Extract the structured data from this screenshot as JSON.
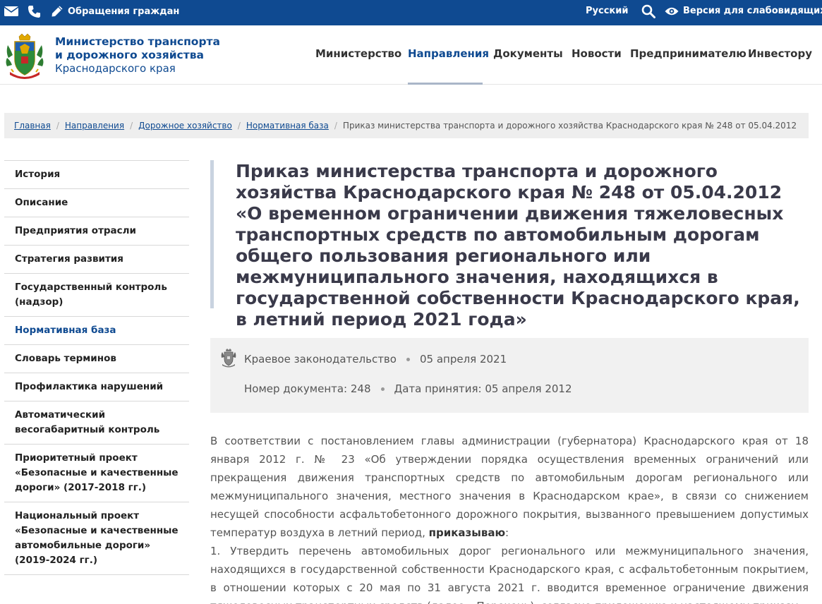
{
  "topbar": {
    "appeals_label": "Обращения граждан",
    "language_label": "Русский",
    "vision_label": "Версия для слабовидящих"
  },
  "header": {
    "org_line1": "Министерство транспорта",
    "org_line2": "и дорожного хозяйства",
    "org_line3": "Краснодарского края",
    "nav": [
      {
        "label": "Министерство"
      },
      {
        "label": "Направления"
      },
      {
        "label": "Документы"
      },
      {
        "label": "Новости"
      },
      {
        "label": "Предпринимателю"
      },
      {
        "label": "Инвестору"
      }
    ],
    "active_nav": "Направления"
  },
  "breadcrumb": {
    "items": [
      "Главная",
      "Направления",
      "Дорожное хозяйство",
      "Нормативная база"
    ],
    "current": "Приказ министерства транспорта и дорожного хозяйства Краснодарского края № 248 от 05.04.2012"
  },
  "sidebar": {
    "items": [
      {
        "label": "История"
      },
      {
        "label": "Описание"
      },
      {
        "label": "Предприятия отрасли"
      },
      {
        "label": "Стратегия развития"
      },
      {
        "label": "Государственный контроль (надзор)"
      },
      {
        "label": "Нормативная база"
      },
      {
        "label": "Словарь терминов"
      },
      {
        "label": "Профилактика нарушений"
      },
      {
        "label": "Автоматический весогабаритный контроль"
      },
      {
        "label": "Приоритетный проект «Безопасные и качественные дороги» (2017-2018 гг.)"
      },
      {
        "label": "Национальный проект «Безопасные и качественные автомобильные дороги» (2019-2024 гг.)"
      }
    ],
    "active": "Нормативная база"
  },
  "document": {
    "title": "Приказ министерства транспорта и дорожного хозяйства Краснодарского края № 248 от 05.04.2012 «О временном ограничении движения тяжеловесных транспортных средств по автомобильным дорогам общего пользования регионального или межмуниципального значения, находящихся в государственной собственности Краснодарского края, в летний период 2021 года»",
    "category": "Краевое законодательство",
    "publish_date": "05 апреля 2021",
    "doc_number": "Номер документа: 248",
    "adoption_date": "Дата принятия: 05 апреля 2012",
    "para1_text": "В соответствии с постановлением главы администрации (губернатора) Краснодарского края от 18 января 2012 г. № 23 «Об утверждении порядка осуществления временных ограничений или прекращения движения транспортных средств по автомобильным дорогам регионального или межмуниципального значения, местного значения в Краснодарском крае», в связи со снижением несущей способности асфальтобетонного дорожного покрытия, вызванного превышением допустимых температур воздуха в летний период, ",
    "para1_bold": "приказываю",
    "para1_end": ":",
    "para2_text": "1. Утвердить перечень автомобильных дорог регионального или межмуниципального значения, находящихся в государственной собственности Краснодарского края, с асфальтобетонным покрытием, в отношении которых с 20 мая по 31 августа 2021 г. вводится временное ограничение движения тяжеловесных транспортных средств (далее – Перечень), согласно приложению к настоящему приказу."
  },
  "colors": {
    "brand_blue": "#0f4a91",
    "title_bar": "#c9d3e0",
    "meta_bg": "#f1f1f1"
  },
  "icons": [
    "mail-icon",
    "phone-icon",
    "pencil-icon",
    "search-icon",
    "eye-icon",
    "coat-of-arms-icon"
  ]
}
